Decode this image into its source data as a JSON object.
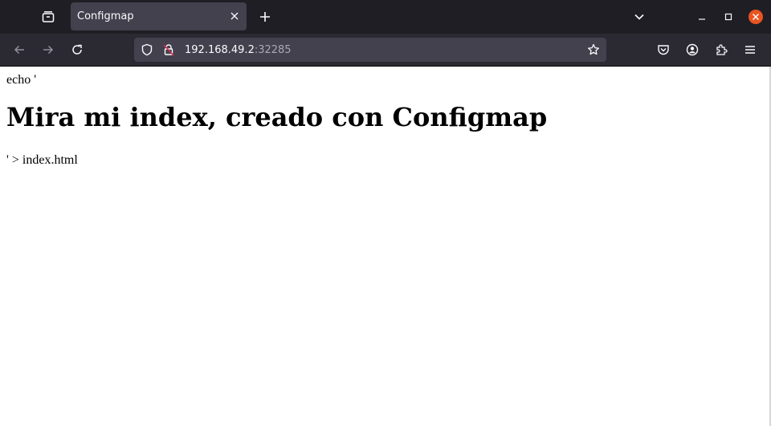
{
  "browser": {
    "tab": {
      "title": "Configmap"
    },
    "url": {
      "host": "192.168.49.2",
      "port": ":32285"
    },
    "colors": {
      "chrome_dark": "#1f1e24",
      "toolbar": "#2b2a33",
      "field": "#42414d",
      "close_accent": "#e95420"
    }
  },
  "page": {
    "line1": "echo '",
    "heading": "Mira mi index, creado con Configmap",
    "line2": "' > index.html"
  },
  "icons": {
    "tab_overview": "tab-overview-icon",
    "new_tab": "plus-icon",
    "list_tabs": "chevron-down-icon",
    "back": "back-arrow-icon",
    "forward": "forward-arrow-icon",
    "reload": "reload-icon",
    "shield": "shield-icon",
    "insecure_lock": "insecure-lock-icon",
    "bookmark": "star-icon",
    "pocket": "pocket-icon",
    "account": "account-icon",
    "extensions": "puzzle-icon",
    "menu": "hamburger-menu-icon"
  }
}
